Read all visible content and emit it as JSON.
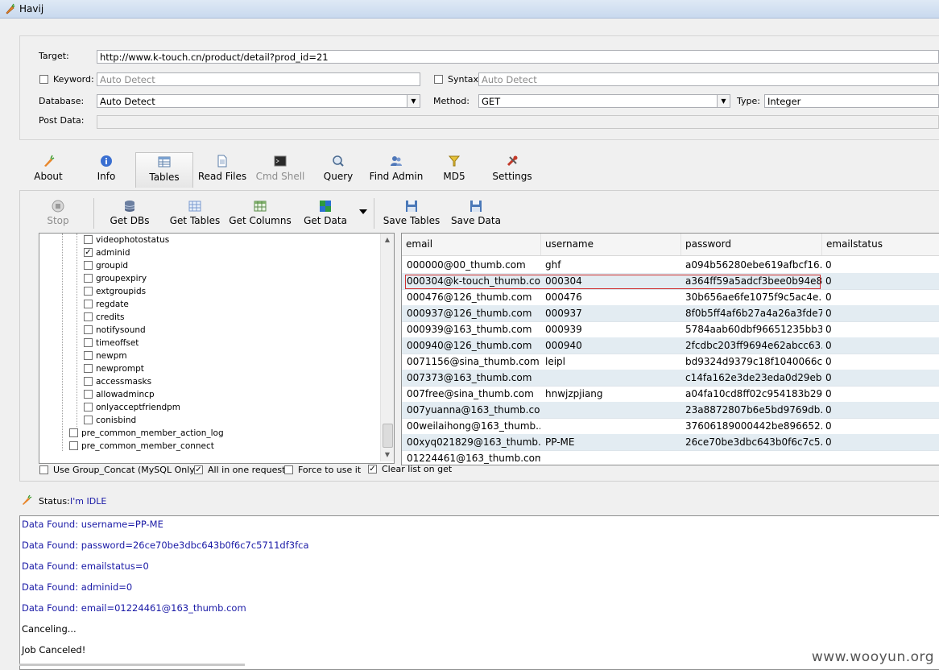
{
  "window": {
    "title": "Havij"
  },
  "target_panel": {
    "target_label": "Target:",
    "target_value": "http://www.k-touch.cn/product/detail?prod_id=21",
    "keyword_label": "Keyword:",
    "keyword_placeholder": "Auto Detect",
    "syntax_label": "Syntax:",
    "syntax_placeholder": "Auto Detect",
    "database_label": "Database:",
    "database_value": "Auto Detect",
    "method_label": "Method:",
    "method_value": "GET",
    "type_label": "Type:",
    "type_value": "Integer",
    "postdata_label": "Post Data:"
  },
  "tabs": [
    {
      "label": "About",
      "icon": "carrot-icon"
    },
    {
      "label": "Info",
      "icon": "info-icon"
    },
    {
      "label": "Tables",
      "icon": "table-icon",
      "active": true
    },
    {
      "label": "Read Files",
      "icon": "file-icon"
    },
    {
      "label": "Cmd Shell",
      "icon": "terminal-icon",
      "disabled": true
    },
    {
      "label": "Query",
      "icon": "query-icon"
    },
    {
      "label": "Find Admin",
      "icon": "users-icon"
    },
    {
      "label": "MD5",
      "icon": "md5-icon"
    },
    {
      "label": "Settings",
      "icon": "tools-icon"
    }
  ],
  "toolbar": {
    "stop": "Stop",
    "get_dbs": "Get DBs",
    "get_tables": "Get Tables",
    "get_columns": "Get Columns",
    "get_data": "Get Data",
    "save_tables": "Save Tables",
    "save_data": "Save Data"
  },
  "tree": {
    "columns": [
      {
        "label": "videophotostatus",
        "checked": false
      },
      {
        "label": "adminid",
        "checked": true
      },
      {
        "label": "groupid",
        "checked": false
      },
      {
        "label": "groupexpiry",
        "checked": false
      },
      {
        "label": "extgroupids",
        "checked": false
      },
      {
        "label": "regdate",
        "checked": false
      },
      {
        "label": "credits",
        "checked": false
      },
      {
        "label": "notifysound",
        "checked": false
      },
      {
        "label": "timeoffset",
        "checked": false
      },
      {
        "label": "newpm",
        "checked": false
      },
      {
        "label": "newprompt",
        "checked": false
      },
      {
        "label": "accessmasks",
        "checked": false
      },
      {
        "label": "allowadmincp",
        "checked": false
      },
      {
        "label": "onlyacceptfriendpm",
        "checked": false
      },
      {
        "label": "conisbind",
        "checked": false
      }
    ],
    "tables": [
      {
        "label": "pre_common_member_action_log",
        "checked": false
      },
      {
        "label": "pre_common_member_connect",
        "checked": false
      }
    ]
  },
  "grid": {
    "headers": [
      "email",
      "username",
      "password",
      "emailstatus"
    ],
    "rows": [
      [
        "000000@00_thumb.com",
        "ghf",
        "a094b56280ebe619afbcf16...",
        "0"
      ],
      [
        "000304@k-touch_thumb.com",
        "000304",
        "a364ff59a5adcf3bee0b94e8...",
        "0"
      ],
      [
        "000476@126_thumb.com",
        "000476",
        "30b656ae6fe1075f9c5ac4e...",
        "0"
      ],
      [
        "000937@126_thumb.com",
        "000937",
        "8f0b5ff4af6b27a4a26a3fde7...",
        "0"
      ],
      [
        "000939@163_thumb.com",
        "000939",
        "5784aab60dbf96651235bb3...",
        "0"
      ],
      [
        "000940@126_thumb.com",
        "000940",
        "2fcdbc203ff9694e62abcc63...",
        "0"
      ],
      [
        "0071156@sina_thumb.com",
        "leipl",
        "bd9324d9379c18f1040066c...",
        "0"
      ],
      [
        "007373@163_thumb.com",
        "",
        "c14fa162e3de23eda0d29eb...",
        "0"
      ],
      [
        "007free@sina_thumb.com",
        "hnwjzpjiang",
        "a04fa10cd8ff02c954183b29...",
        "0"
      ],
      [
        "007yuanna@163_thumb.com",
        "",
        "23a8872807b6e5bd9769db...",
        "0"
      ],
      [
        "00weilaihong@163_thumb....",
        "",
        "37606189000442be896652...",
        "0"
      ],
      [
        "00xyq021829@163_thumb...",
        "PP-ME",
        "26ce70be3dbc643b0f6c7c5...",
        "0"
      ],
      [
        "01224461@163_thumb.com",
        "",
        "",
        ""
      ]
    ]
  },
  "options": {
    "group_concat": "Use Group_Concat (MySQL Only)",
    "all_in_one": "All in one request.",
    "force": "Force to use it",
    "clear_list": "Clear list on get"
  },
  "status": {
    "label": "Status:",
    "value": "I'm IDLE"
  },
  "log": [
    "Data Found: username=PP-ME",
    "Data Found: password=26ce70be3dbc643b0f6c7c5711df3fca",
    "Data Found: emailstatus=0",
    "Data Found: adminid=0",
    "Data Found: email=01224461@163_thumb.com",
    "Canceling...",
    "Job Canceled!"
  ],
  "watermark": "www.wooyun.org",
  "colors": {
    "log_found": "#1a1aa6",
    "row_alt": "#e3ecf2",
    "selection_border": "#d03030"
  }
}
